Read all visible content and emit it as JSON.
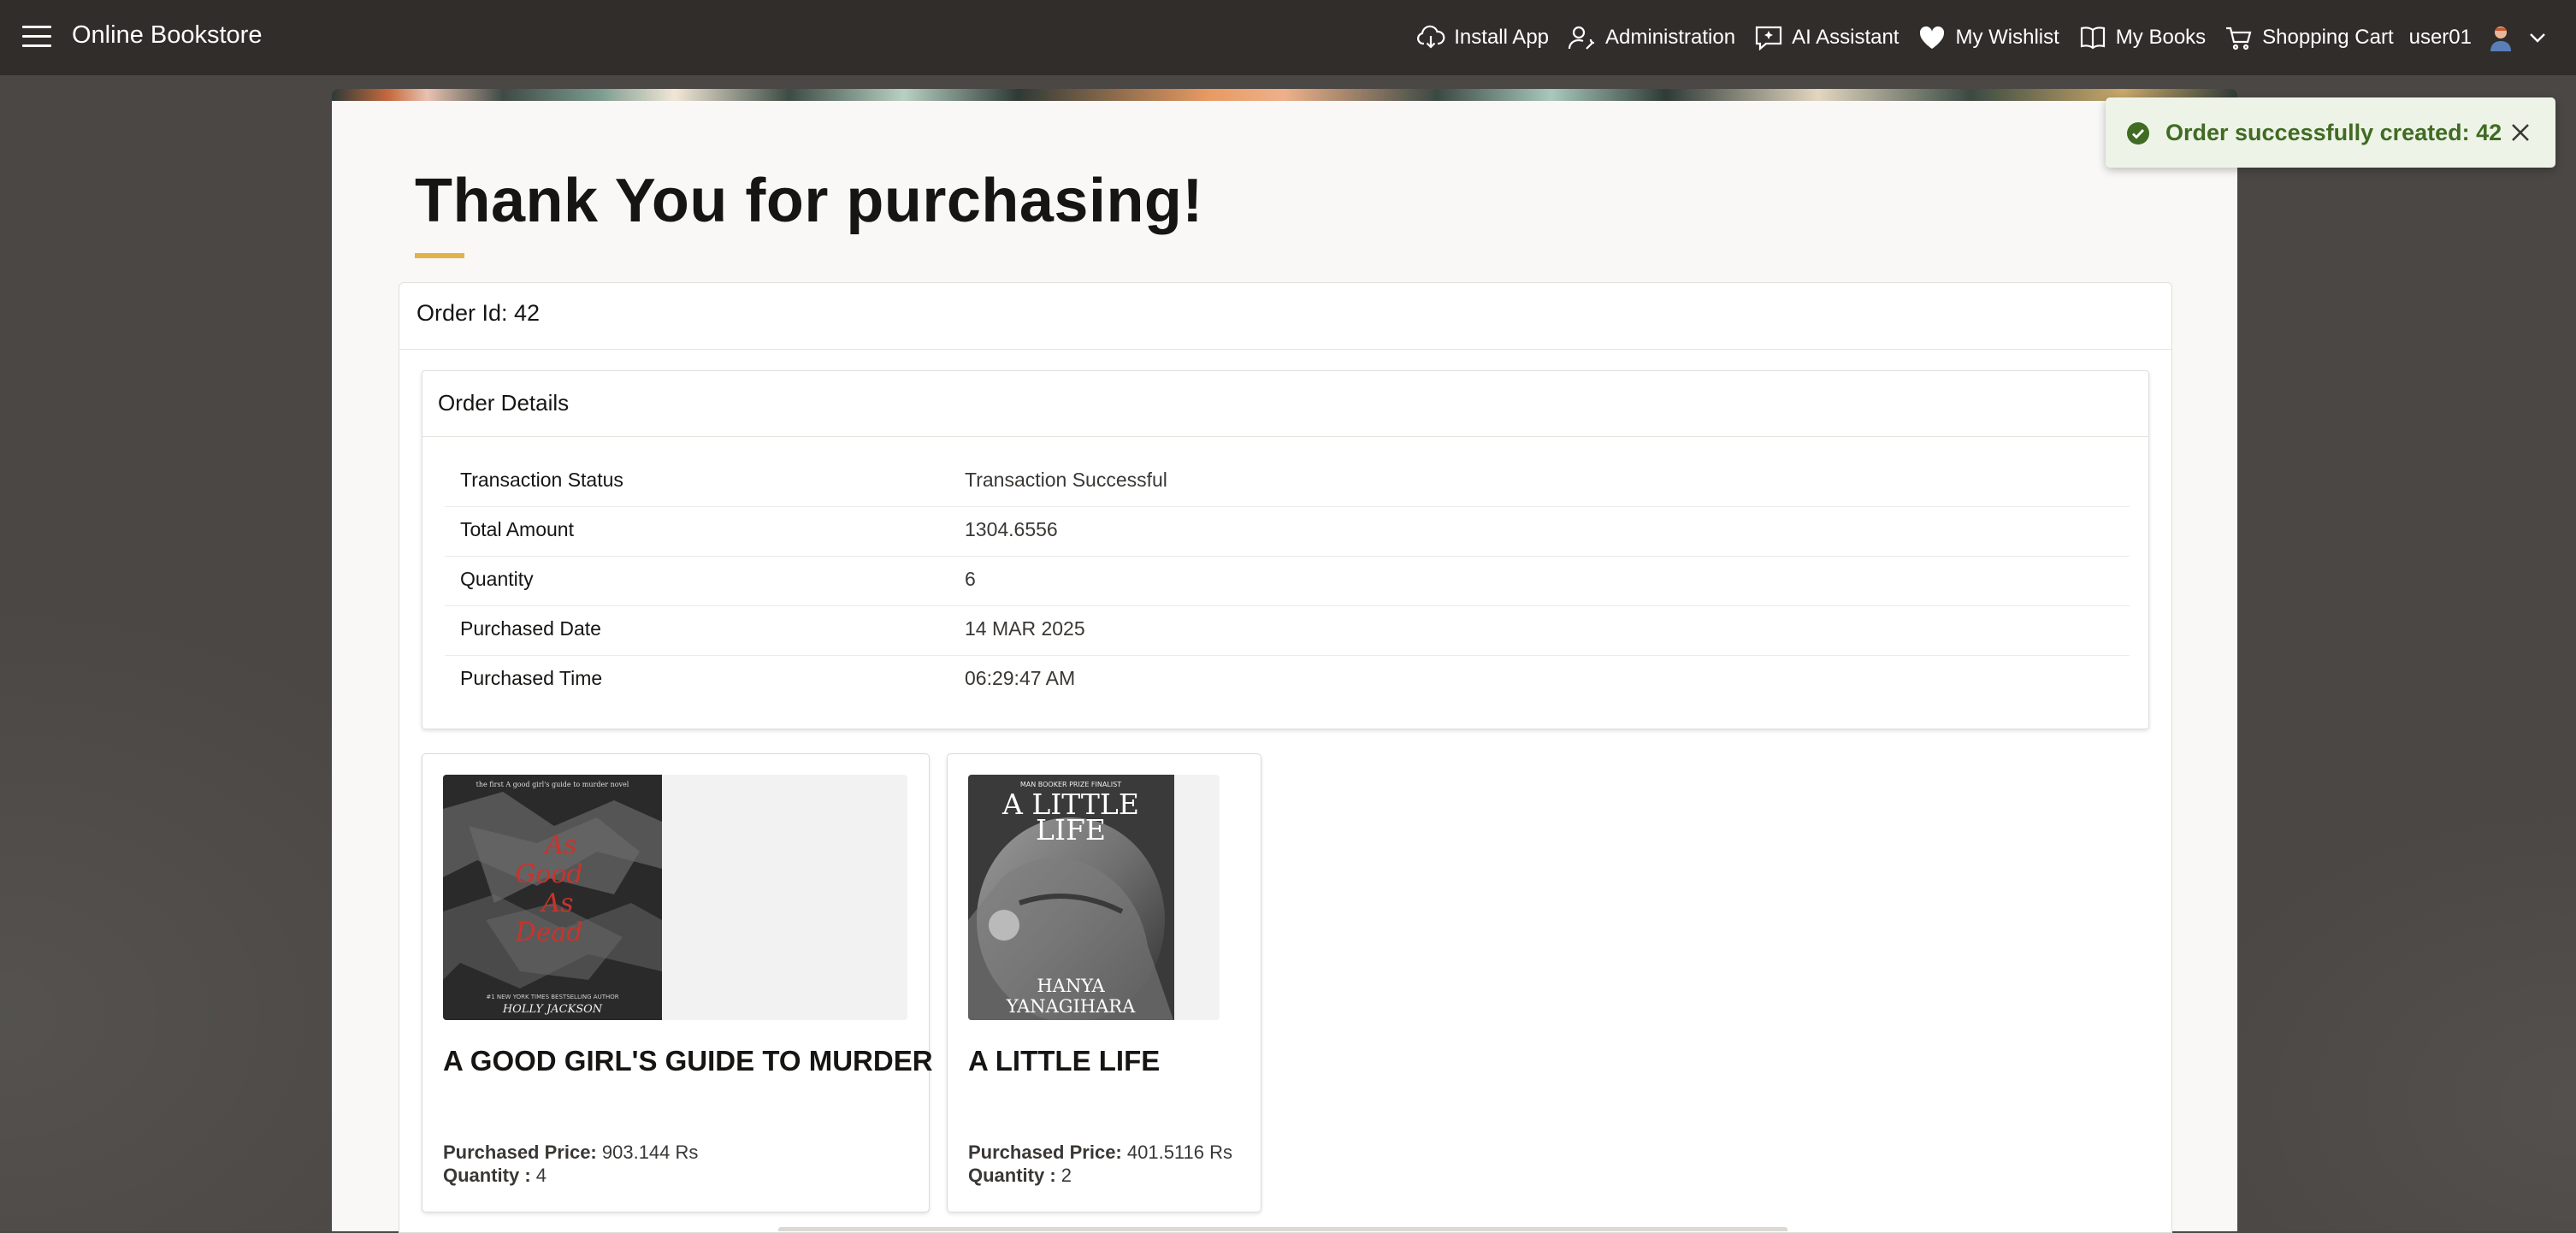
{
  "header": {
    "app_title": "Online Bookstore",
    "nav": [
      {
        "label": "Install App",
        "icon": "cloud-download-icon"
      },
      {
        "label": "Administration",
        "icon": "user-wrench-icon"
      },
      {
        "label": "AI Assistant",
        "icon": "chat-sparkle-icon"
      },
      {
        "label": "My Wishlist",
        "icon": "heart-icon"
      },
      {
        "label": "My Books",
        "icon": "book-open-icon"
      },
      {
        "label": "Shopping Cart",
        "icon": "cart-icon"
      }
    ],
    "user": "user01"
  },
  "page": {
    "title": "Thank You for purchasing!",
    "order_id": "Order Id: 42",
    "details_title": "Order Details",
    "details": [
      {
        "label": "Transaction Status",
        "value": "Transaction Successful"
      },
      {
        "label": "Total Amount",
        "value": "1304.6556"
      },
      {
        "label": "Quantity",
        "value": "6"
      },
      {
        "label": "Purchased Date",
        "value": "14 MAR 2025"
      },
      {
        "label": "Purchased Time",
        "value": "06:29:47 AM"
      }
    ]
  },
  "books": [
    {
      "title": "A GOOD GIRL'S GUIDE TO MURDER",
      "price_label": "Purchased Price:",
      "price": "903.144 Rs",
      "qty_label": "Quantity :",
      "qty": "4",
      "cover_lines": [
        "As",
        "Good",
        "As",
        "Dead"
      ],
      "cover_author": "HOLLY JACKSON"
    },
    {
      "title": "A LITTLE LIFE",
      "price_label": "Purchased Price:",
      "price": "401.5116 Rs",
      "qty_label": "Quantity :",
      "qty": "2",
      "cover_top": "MAN BOOKER PRIZE FINALIST",
      "cover_title_1": "A LITTLE",
      "cover_title_2": "LIFE",
      "cover_author_1": "HANYA",
      "cover_author_2": "YANAGIHARA"
    }
  ],
  "toast": {
    "message": "Order successfully created: 42"
  },
  "colors": {
    "header_bg": "#312d2a",
    "accent_underline": "#e0b44a",
    "toast_bg": "#eef3e7",
    "toast_text": "#3f6b23"
  }
}
